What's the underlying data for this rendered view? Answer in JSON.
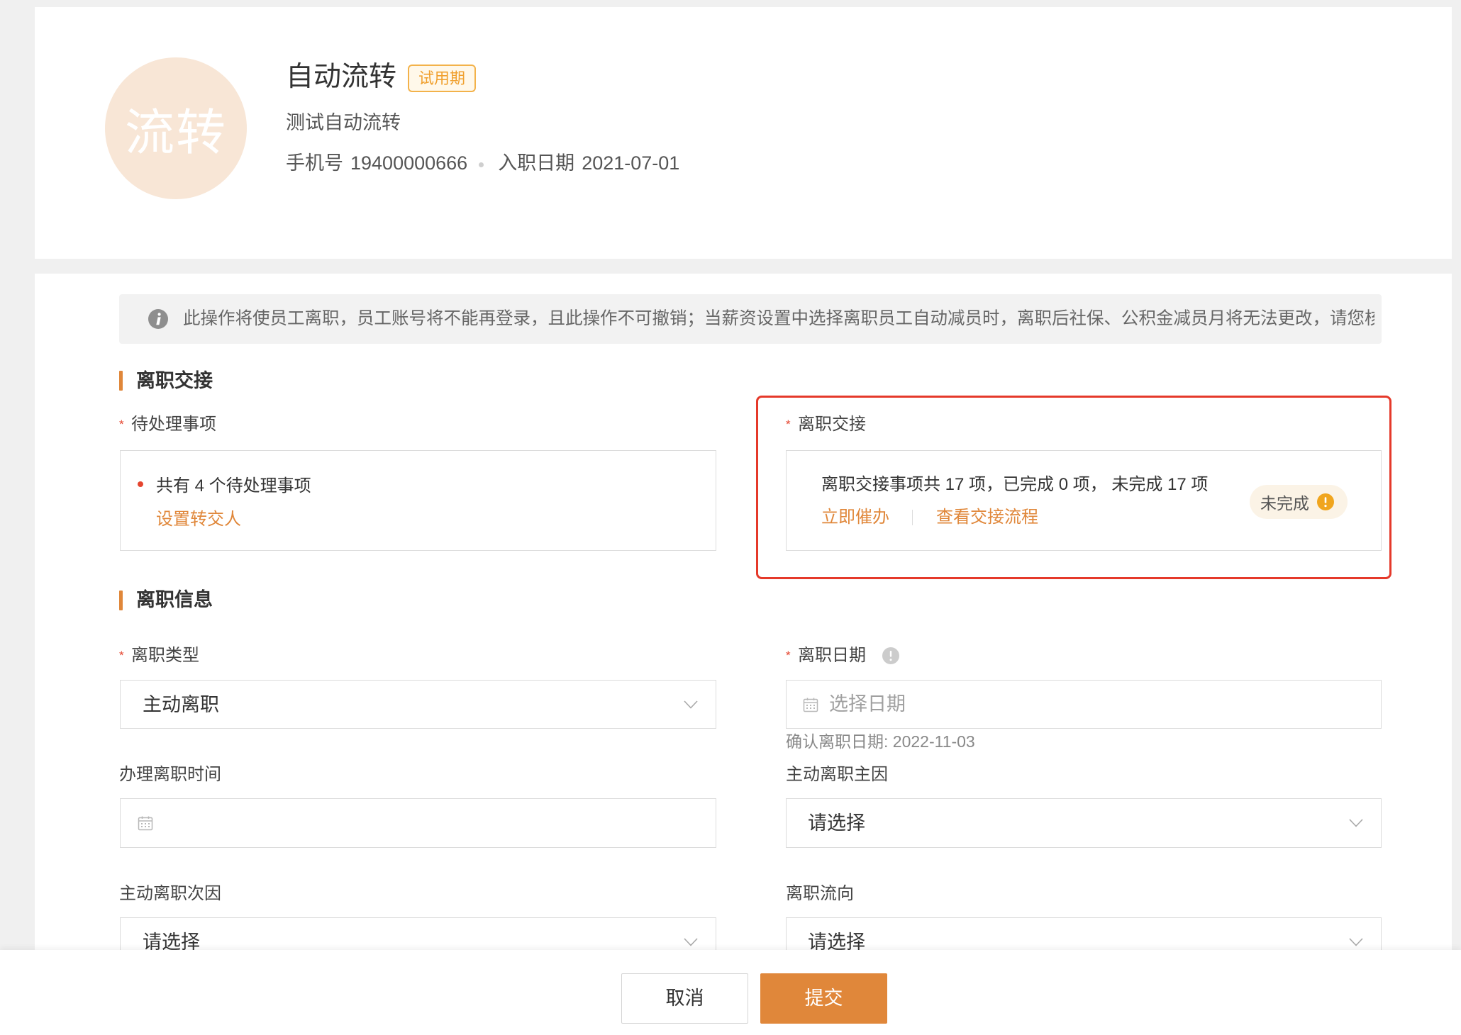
{
  "colors": {
    "accent": "#e0873a",
    "required": "#e5452f",
    "highlight": "#e5392a",
    "avatar": "#f8e6d6",
    "warning": "#f0a51e",
    "trial_badge": "#f0a02e"
  },
  "profile": {
    "avatar_text": "流转",
    "name": "自动流转",
    "status_badge": "试用期",
    "description": "测试自动流转",
    "phone_label": "手机号",
    "phone": "19400000666",
    "hire_date_label": "入职日期",
    "hire_date": "2021-07-01"
  },
  "notice": {
    "icon": "info-icon",
    "text": "此操作将使员工离职，员工账号将不能再登录，且此操作不可撤销；当薪资设置中选择离职员工自动减员时，离职后社保、公积金减员月将无法更改，请您核对"
  },
  "handover_section": {
    "title": "离职交接",
    "pending_items": {
      "required_mark": "*",
      "label": "待处理事项",
      "summary": "共有 4 个待处理事项",
      "action": "设置转交人"
    },
    "handover": {
      "required_mark": "*",
      "label": "离职交接",
      "summary": "离职交接事项共 17 项，已完成 0 项， 未完成 17 项",
      "urge_action": "立即催办",
      "view_flow_action": "查看交接流程",
      "status": "未完成",
      "status_icon": "warning-icon"
    }
  },
  "info_section": {
    "title": "离职信息",
    "resignation_type": {
      "required_mark": "*",
      "label": "离职类型",
      "value": "主动离职"
    },
    "resignation_date": {
      "required_mark": "*",
      "label": "离职日期",
      "help_icon": "help-icon",
      "placeholder": "选择日期",
      "hint": "确认离职日期: 2022-11-03"
    },
    "processing_time": {
      "label": "办理离职时间",
      "icon": "calendar-icon"
    },
    "primary_reason": {
      "label": "主动离职主因",
      "value": "请选择"
    },
    "secondary_reason": {
      "label": "主动离职次因",
      "value": "请选择"
    },
    "destination": {
      "label": "离职流向",
      "value": "请选择"
    }
  },
  "footer": {
    "cancel_label": "取消",
    "submit_label": "提交"
  }
}
